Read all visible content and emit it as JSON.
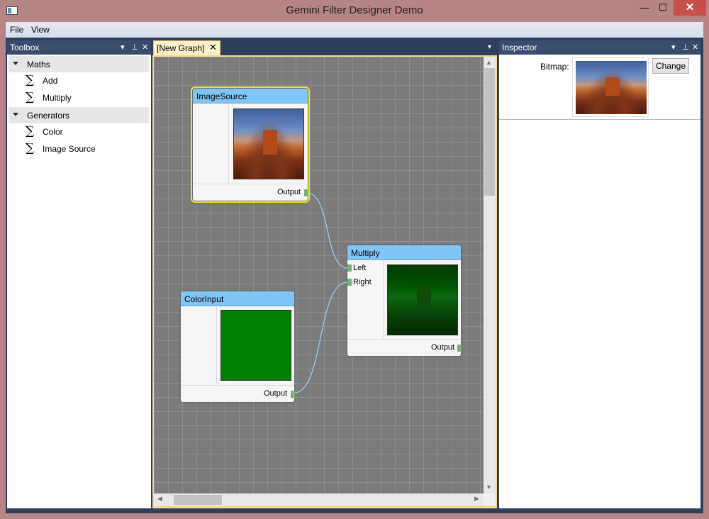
{
  "window": {
    "title": "Gemini Filter Designer Demo",
    "controls": {
      "minimize": "—",
      "maximize": "☐",
      "close": "✕"
    }
  },
  "menu": [
    "File",
    "View"
  ],
  "toolbox": {
    "title": "Toolbox",
    "header_controls": [
      "▾",
      "⊥",
      "✕"
    ],
    "groups": [
      {
        "label": "Maths",
        "items": [
          "Add",
          "Multiply"
        ]
      },
      {
        "label": "Generators",
        "items": [
          "Color",
          "Image Source"
        ]
      }
    ],
    "item_icon": "sigma-icon"
  },
  "document": {
    "tab_label": "[New Graph]",
    "tab_close": "✕",
    "menu_glyph": "▾"
  },
  "graph": {
    "nodes": {
      "image_source": {
        "title": "ImageSource",
        "output": "Output",
        "preview": "desert-photo",
        "selected": true
      },
      "multiply": {
        "title": "Multiply",
        "inputs": [
          "Left",
          "Right"
        ],
        "output": "Output",
        "preview": "green-tinted-desert"
      },
      "color_input": {
        "title": "ColorInput",
        "output": "Output",
        "preview_color": "#008000"
      }
    },
    "connections": [
      {
        "from": "ImageSource.Output",
        "to": "Multiply.Left"
      },
      {
        "from": "ColorInput.Output",
        "to": "Multiply.Right"
      }
    ],
    "connection_color": "#9fcbe8",
    "node_header_color": "#7fc5f7",
    "selection_color": "#f2e31c"
  },
  "inspector": {
    "title": "Inspector",
    "header_controls": [
      "▾",
      "⊥",
      "✕"
    ],
    "bitmap_label": "Bitmap:",
    "change_button": "Change"
  }
}
